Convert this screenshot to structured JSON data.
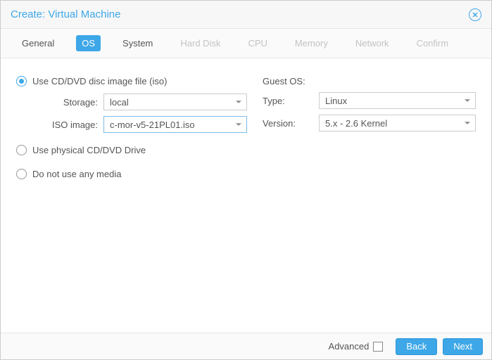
{
  "window": {
    "title": "Create: Virtual Machine"
  },
  "tabs": [
    {
      "label": "General",
      "state": "done"
    },
    {
      "label": "OS",
      "state": "active"
    },
    {
      "label": "System",
      "state": "done"
    },
    {
      "label": "Hard Disk",
      "state": "disabled"
    },
    {
      "label": "CPU",
      "state": "disabled"
    },
    {
      "label": "Memory",
      "state": "disabled"
    },
    {
      "label": "Network",
      "state": "disabled"
    },
    {
      "label": "Confirm",
      "state": "disabled"
    }
  ],
  "media": {
    "iso_radio": "Use CD/DVD disc image file (iso)",
    "physical_radio": "Use physical CD/DVD Drive",
    "none_radio": "Do not use any media",
    "storage_label": "Storage:",
    "storage_value": "local",
    "iso_label": "ISO image:",
    "iso_value": "c-mor-v5-21PL01.iso"
  },
  "guest": {
    "heading": "Guest OS:",
    "type_label": "Type:",
    "type_value": "Linux",
    "version_label": "Version:",
    "version_value": "5.x - 2.6 Kernel"
  },
  "footer": {
    "advanced_label": "Advanced",
    "back_label": "Back",
    "next_label": "Next"
  }
}
